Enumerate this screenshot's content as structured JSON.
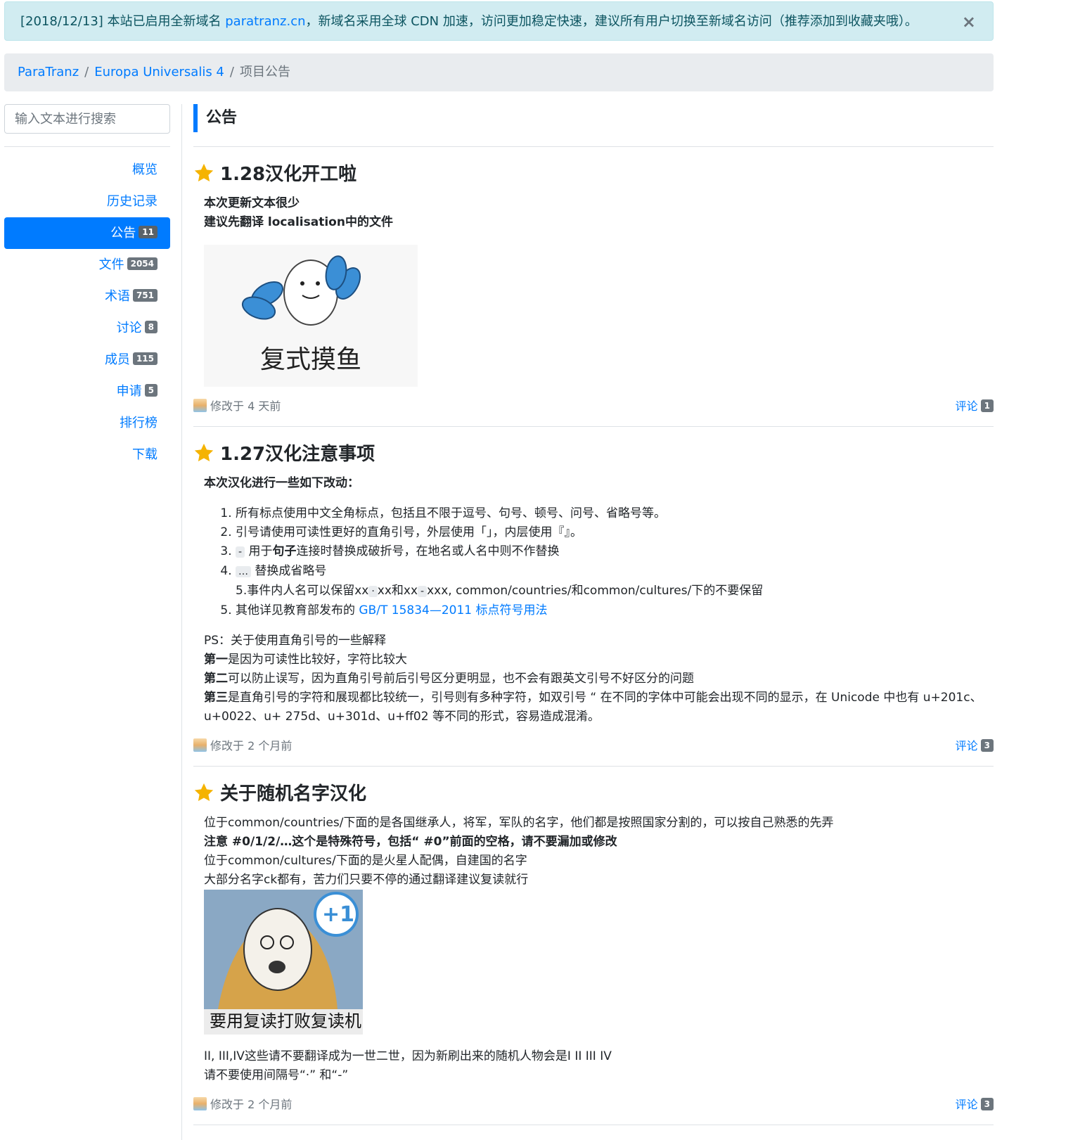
{
  "alert": {
    "prefix": "[2018/12/13] 本站已启用全新域名 ",
    "link": "paratranz.cn",
    "suffix": "，新域名采用全球 CDN 加速，访问更加稳定快速，建议所有用户切换至新域名访问（推荐添加到收藏夹哦）。",
    "close": "×"
  },
  "breadcrumb": {
    "root": "ParaTranz",
    "project": "Europa Universalis 4",
    "current": "项目公告",
    "sep": "/"
  },
  "search": {
    "placeholder": "输入文本进行搜索"
  },
  "nav": [
    {
      "label": "概览"
    },
    {
      "label": "历史记录"
    },
    {
      "label": "公告",
      "badge": "11"
    },
    {
      "label": "文件",
      "badge": "2054"
    },
    {
      "label": "术语",
      "badge": "751"
    },
    {
      "label": "讨论",
      "badge": "8"
    },
    {
      "label": "成员",
      "badge": "115"
    },
    {
      "label": "申请",
      "badge": "5"
    },
    {
      "label": "排行榜"
    },
    {
      "label": "下载"
    }
  ],
  "section": {
    "title": "公告"
  },
  "announcements": [
    {
      "title": "1.28汉化开工啦",
      "lines": [
        "本次更新文本很少",
        "建议先翻译 localisation中的文件"
      ],
      "image_caption": "复式摸鱼",
      "meta": "修改于 4 天前",
      "comment_label": "评论",
      "comment_count": "1"
    },
    {
      "title": "1.27汉化注意事项",
      "intro": "本次汉化进行一些如下改动：",
      "items": {
        "i1": "所有标点使用中文全角标点，包括且不限于逗号、句号、顿号、问号、省略号等。",
        "i2": "引号请使用可读性更好的直角引号，外层使用「」，内层使用『』。",
        "i3_code": "-",
        "i3_a": " 用于",
        "i3_bold": "句子",
        "i3_b": "连接时替换成破折号，在地名或人名中则不作替换",
        "i4_code": "…",
        "i4_a": " 替换成省略号",
        "sub_a": "5.事件内人名可以保留xx",
        "sub_code1": "·",
        "sub_b": "xx和xx",
        "sub_code2": "-",
        "sub_c": "xxx, common/countries/和common/cultures/下的不要保留",
        "i5_a": "其他详见教育部发布的 ",
        "i5_link": "GB/T 15834—2011 标点符号用法"
      },
      "ps": "PS：关于使用直角引号的一些解释",
      "p1_bold": "第一",
      "p1": "是因为可读性比较好，字符比较大",
      "p2_bold": "第二",
      "p2": "可以防止误写，因为直角引号前后引号区分更明显，也不会有跟英文引号不好区分的问题",
      "p3_bold": "第三",
      "p3": "是直角引号的字符和展现都比较统一，引号则有多种字符，如双引号 “ 在不同的字体中可能会出现不同的显示，在 Unicode 中也有 u+201c、u+0022、u+ 275d、u+301d、u+ff02 等不同的形式，容易造成混淆。",
      "meta": "修改于 2 个月前",
      "comment_label": "评论",
      "comment_count": "3"
    },
    {
      "title": "关于随机名字汉化",
      "l1": "位于common/countries/下面的是各国继承人，将军，军队的名字，他们都是按照国家分割的，可以按自己熟悉的先弄",
      "l2": "注意 #0/1/2/…这个是特殊符号，包括“ #0”前面的空格，请不要漏加或修改",
      "l3": "位于common/cultures/下面的是火星人配偶，自建国的名字",
      "l4": "大部分名字ck都有，苦力们只要不停的通过翻译建议复读就行",
      "image_caption": "要用复读打败复读机",
      "image_badge": "+1",
      "l5": "II, III,IV这些请不要翻译成为一世二世，因为新刷出来的随机人物会是I II III IV",
      "l6": "请不要使用间隔号“·” 和“-”",
      "meta": "修改于 2 个月前",
      "comment_label": "评论",
      "comment_count": "3"
    }
  ],
  "colors": {
    "primary": "#007bff",
    "star": "#f5b301",
    "alert_bg": "#d1ecf1"
  }
}
